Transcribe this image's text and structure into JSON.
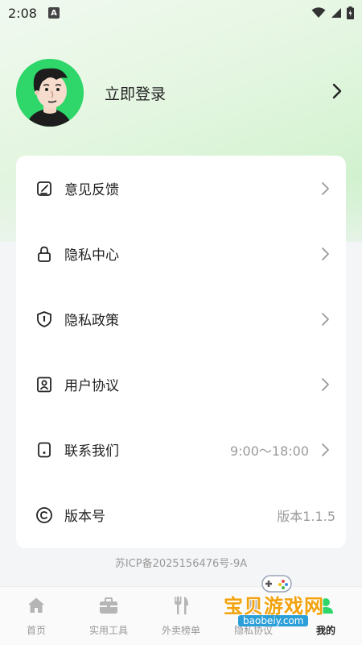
{
  "status_bar": {
    "time": "2:08",
    "notification_letter": "A",
    "icons": [
      "wifi-icon",
      "signal-icon",
      "battery-icon"
    ]
  },
  "profile": {
    "login_label": "立即登录",
    "avatar": "cartoon-man-avatar"
  },
  "menu": [
    {
      "label": "意见反馈",
      "icon": "feedback-icon",
      "value": "",
      "arrow": true
    },
    {
      "label": "隐私中心",
      "icon": "lock-icon",
      "value": "",
      "arrow": true
    },
    {
      "label": "隐私政策",
      "icon": "shield-icon",
      "value": "",
      "arrow": true
    },
    {
      "label": "用户协议",
      "icon": "user-agreement-icon",
      "value": "",
      "arrow": true
    },
    {
      "label": "联系我们",
      "icon": "phone-icon",
      "value": "9:00～18:00",
      "arrow": true
    },
    {
      "label": "版本号",
      "icon": "copyright-icon",
      "value": "版本1.1.5",
      "arrow": false
    }
  ],
  "icp": "苏ICP备2025156476号-9A",
  "tabs": [
    {
      "label": "首页",
      "icon": "home-icon",
      "active": false
    },
    {
      "label": "实用工具",
      "icon": "toolbox-icon",
      "active": false
    },
    {
      "label": "外卖榜单",
      "icon": "fork-knife-icon",
      "active": false
    },
    {
      "label": "隐私协议",
      "icon": "document-icon",
      "active": false
    },
    {
      "label": "我的",
      "icon": "user-icon",
      "active": true
    }
  ],
  "watermark": {
    "title": "宝贝游戏网",
    "url": "baobeiy.com"
  },
  "colors": {
    "accent_green": "#2fd66a",
    "watermark_orange": "#f2a20c",
    "watermark_blue": "#2a9fd8"
  }
}
